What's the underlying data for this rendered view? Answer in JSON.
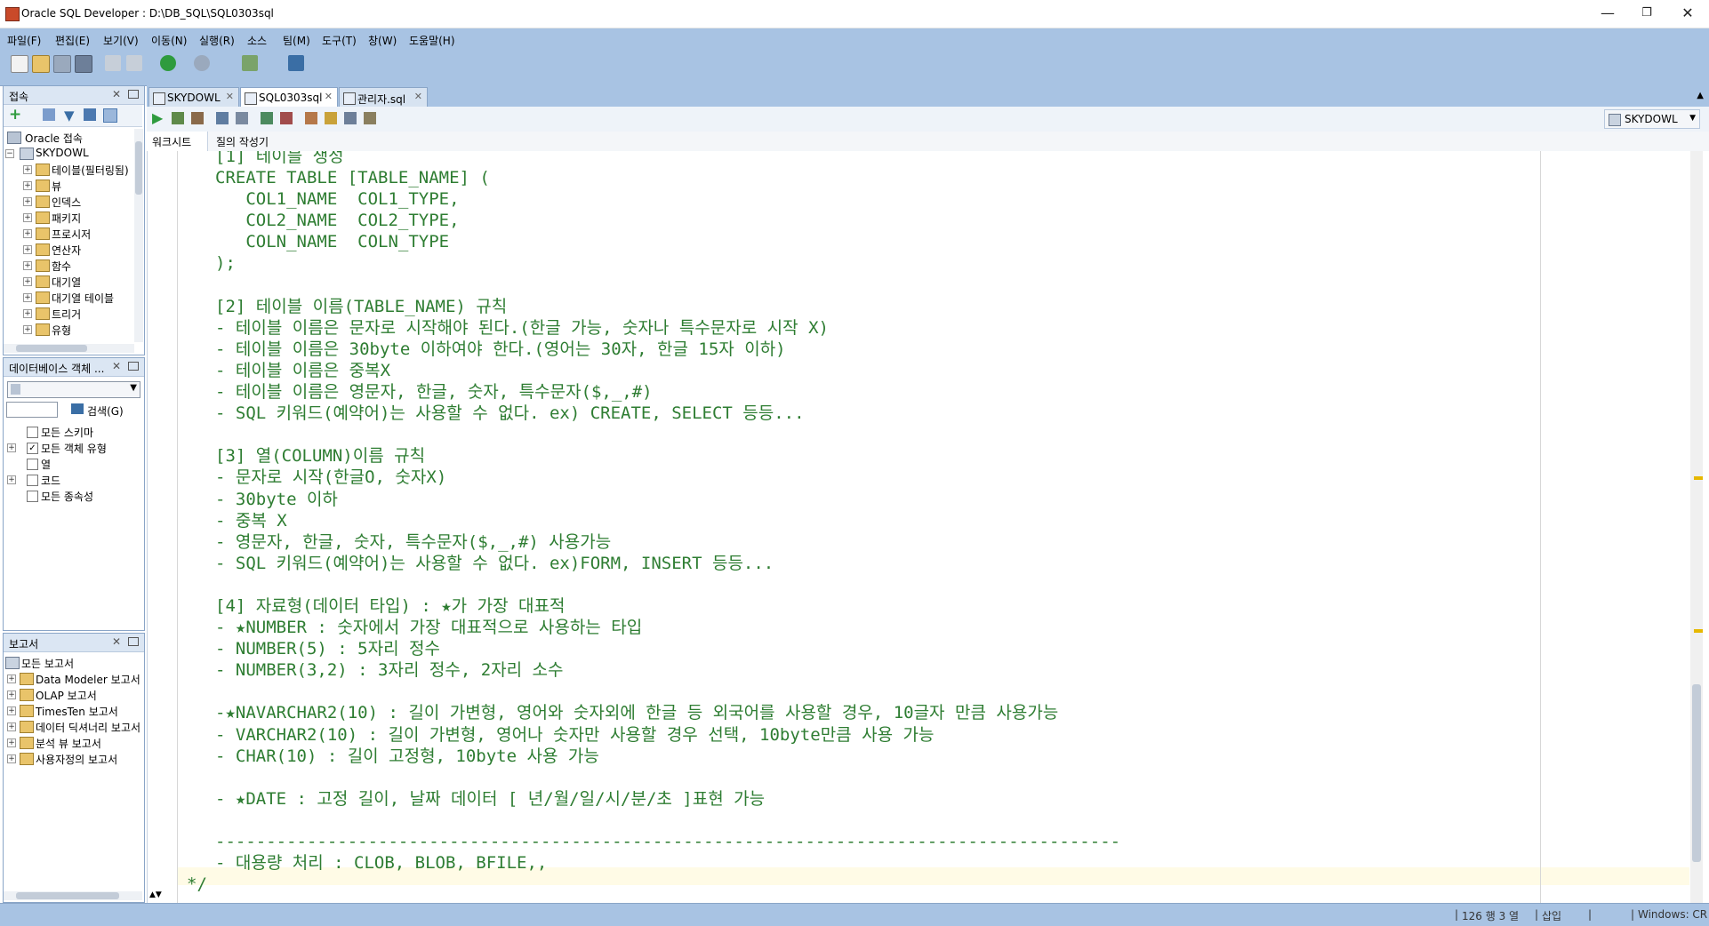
{
  "window": {
    "title": "Oracle SQL Developer : D:\\DB_SQL\\SQL0303sql"
  },
  "menu": [
    "파일(F)",
    "편집(E)",
    "보기(V)",
    "이동(N)",
    "실행(R)",
    "소스",
    "팀(M)",
    "도구(T)",
    "창(W)",
    "도움말(H)"
  ],
  "connections": {
    "title": "접속",
    "root": "Oracle 접속",
    "conn": "SKYDOWL",
    "items": [
      "테이블(필터링됨)",
      "뷰",
      "인덱스",
      "패키지",
      "프로시저",
      "연산자",
      "함수",
      "대기열",
      "대기열 테이블",
      "트리거",
      "유형"
    ]
  },
  "dbobjects": {
    "title": "데이터베이스 객체 ...",
    "search_label": "검색(G)",
    "items": [
      {
        "label": "모든 스키마",
        "checked": false,
        "expand": false
      },
      {
        "label": "모든 객체 유형",
        "checked": true,
        "expand": true
      },
      {
        "label": "열",
        "checked": false,
        "expand": false
      },
      {
        "label": "코드",
        "checked": false,
        "expand": true
      },
      {
        "label": "모든 종속성",
        "checked": false,
        "expand": false
      }
    ]
  },
  "reports": {
    "title": "보고서",
    "root": "모든 보고서",
    "items": [
      "Data Modeler 보고서",
      "OLAP 보고서",
      "TimesTen 보고서",
      "데이터 딕셔너리 보고서",
      "분석 뷰 보고서",
      "사용자정의 보고서"
    ]
  },
  "tabs": [
    {
      "label": "SKYDOWL",
      "active": false
    },
    {
      "label": "SQL0303sql",
      "active": true
    },
    {
      "label": "관리자.sql",
      "active": false
    }
  ],
  "editor": {
    "connection": "SKYDOWL",
    "subtabs": [
      "워크시트",
      "질의 작성기"
    ],
    "lines": [
      "[1] 테이블 생성",
      "CREATE TABLE [TABLE_NAME] (",
      "   COL1_NAME  COL1_TYPE,",
      "   COL2_NAME  COL2_TYPE,",
      "   COLN_NAME  COLN_TYPE",
      ");",
      "",
      "[2] 테이블 이름(TABLE_NAME) 규칙",
      "- 테이블 이름은 문자로 시작해야 된다.(한글 가능, 숫자나 특수문자로 시작 X)",
      "- 테이블 이름은 30byte 이하여야 한다.(영어는 30자, 한글 15자 이하)",
      "- 테이블 이름은 중복X",
      "- 테이블 이름은 영문자, 한글, 숫자, 특수문자($,_,#)",
      "- SQL 키워드(예약어)는 사용할 수 없다. ex) CREATE, SELECT 등등...",
      "",
      "[3] 열(COLUMN)이름 규칙",
      "- 문자로 시작(한글O, 숫자X)",
      "- 30byte 이하",
      "- 중복 X",
      "- 영문자, 한글, 숫자, 특수문자($,_,#) 사용가능",
      "- SQL 키워드(예약어)는 사용할 수 없다. ex)FORM, INSERT 등등...",
      "",
      "[4] 자료형(데이터 타입) : ★가 가장 대표적",
      "- ★NUMBER : 숫자에서 가장 대표적으로 사용하는 타입",
      "- NUMBER(5) : 5자리 정수",
      "- NUMBER(3,2) : 3자리 정수, 2자리 소수",
      "",
      "-★NAVARCHAR2(10) : 길이 가변형, 영어와 숫자외에 한글 등 외국어를 사용할 경우, 10글자 만큼 사용가능",
      "- VARCHAR2(10) : 길이 가변형, 영어나 숫자만 사용할 경우 선택, 10byte만큼 사용 가능",
      "- CHAR(10) : 길이 고정형, 10byte 사용 가능",
      "",
      "- ★DATE : 고정 길이, 날짜 데이터 [ 년/월/일/시/분/초 ]표현 가능",
      "",
      "-----------------------------------------------------------------------------------------",
      "- 대용량 처리 : CLOB, BLOB, BFILE,,",
      "*/"
    ]
  },
  "status": {
    "position": "126 행 3 열",
    "mode": "삽입",
    "eol": "Windows: CR"
  },
  "colors": {
    "accent": "#a8c3e3",
    "code": "#2e7d32"
  }
}
